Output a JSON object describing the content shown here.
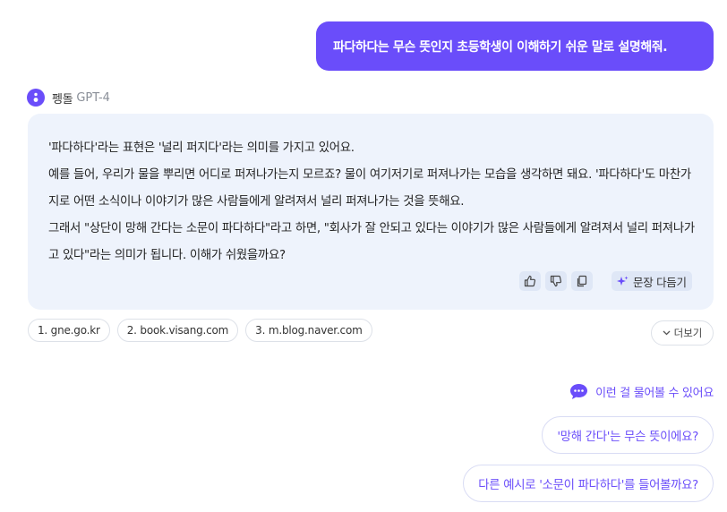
{
  "user_message": "파다하다는 무슨 뜻인지 초등학생이 이해하기 쉬운 말로 설명해줘.",
  "bot": {
    "name": "펭돌",
    "model": "GPT-4",
    "paragraphs": [
      "'파다하다'라는 표현은 '널리 퍼지다'라는 의미를 가지고 있어요.",
      "예를 들어, 우리가 물을 뿌리면 어디로 퍼져나가는지 모르죠? 물이 여기저기로 퍼져나가는 모습을 생각하면 돼요. '파다하다'도 마찬가지로 어떤 소식이나 이야기가 많은 사람들에게 알려져서 널리 퍼져나가는 것을 뜻해요.",
      "그래서 \"상단이 망해 간다는 소문이 파다하다\"라고 하면, \"회사가 잘 안되고 있다는 이야기가 많은 사람들에게 알려져서 널리 퍼져나가고 있다\"라는 의미가 됩니다. 이해가 쉬웠을까요?"
    ],
    "actions": {
      "like_icon": "thumbs-up-icon",
      "dislike_icon": "thumbs-down-icon",
      "copy_icon": "copy-icon",
      "polish_label": "문장 다듬기"
    }
  },
  "sources": [
    "1. gne.go.kr",
    "2. book.visang.com",
    "3. m.blog.naver.com"
  ],
  "more_label": "더보기",
  "suggestions": {
    "header": "이런 걸 물어볼 수 있어요",
    "items": [
      "'망해 간다'는 무슨 뜻이에요?",
      "다른 예시로 '소문이 파다하다'를 들어볼까요?"
    ]
  },
  "colors": {
    "accent": "#6a4dfa",
    "answer_bg": "#eef3fc"
  }
}
